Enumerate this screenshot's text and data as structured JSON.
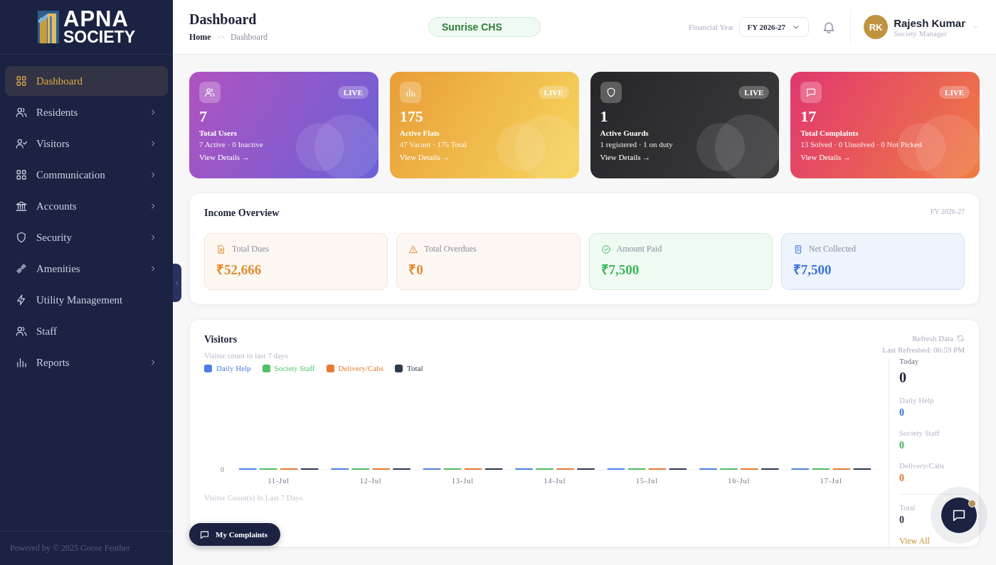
{
  "sidebar": {
    "logo": {
      "line_1": "APNA",
      "line_2": "SOCIETY"
    },
    "items": [
      {
        "label": "Dashboard",
        "kind": "grid",
        "selected": true,
        "has_submenu": false
      },
      {
        "label": "Residents",
        "kind": "users",
        "selected": false,
        "has_submenu": true
      },
      {
        "label": "Visitors",
        "kind": "user-check",
        "selected": false,
        "has_submenu": true
      },
      {
        "label": "Communication",
        "kind": "grid",
        "selected": false,
        "has_submenu": true
      },
      {
        "label": "Accounts",
        "kind": "bank",
        "selected": false,
        "has_submenu": true
      },
      {
        "label": "Security",
        "kind": "shield",
        "selected": false,
        "has_submenu": true
      },
      {
        "label": "Amenities",
        "kind": "dumbbell",
        "selected": false,
        "has_submenu": true
      },
      {
        "label": "Utility Management",
        "kind": "bolt",
        "selected": false,
        "has_submenu": false
      },
      {
        "label": "Staff",
        "kind": "users",
        "selected": false,
        "has_submenu": false
      },
      {
        "label": "Reports",
        "kind": "bars",
        "selected": false,
        "has_submenu": true
      }
    ],
    "footer": "Powered by © 2025 Goose Feather"
  },
  "header": {
    "title": "Dashboard",
    "breadcrumb": {
      "home": "Home",
      "separator": ">>",
      "current": "Dashboard"
    },
    "society": "Sunrise CHS",
    "financial_year": {
      "label": "Financial Year",
      "value": "FY 2026-27"
    },
    "user": {
      "initials": "RK",
      "name": "Rajesh Kumar",
      "role": "Society Manager"
    }
  },
  "stat_cards": [
    {
      "kind": "users",
      "badge": "LIVE",
      "value": "7",
      "title": "Total Users",
      "detail": "7 Active · 0 Inactive",
      "link": "View Details →"
    },
    {
      "kind": "flats",
      "badge": "LIVE",
      "value": "175",
      "title": "Active Flats",
      "detail": "47 Vacant · 175 Total",
      "link": "View Details →"
    },
    {
      "kind": "guards",
      "badge": "LIVE",
      "value": "1",
      "title": "Active Guards",
      "detail": "1 registered · 1 on duty",
      "link": "View Details →"
    },
    {
      "kind": "complaints",
      "badge": "LIVE",
      "value": "17",
      "title": "Total Complaints",
      "detail": "13 Solved · 0 Unsolved · 0 Not Picked",
      "link": "View Details →"
    }
  ],
  "income": {
    "title": "Income Overview",
    "period": "FY 2026-27",
    "tiles": [
      {
        "kind": "dues",
        "label": "Total Dues",
        "value": "₹52,666"
      },
      {
        "kind": "overdues",
        "label": "Total Overdues",
        "value": "₹0"
      },
      {
        "kind": "paid",
        "label": "Amount Paid",
        "value": "₹7,500"
      },
      {
        "kind": "net",
        "label": "Net Collected",
        "value": "₹7,500"
      }
    ]
  },
  "visitors": {
    "title": "Visitors",
    "subtitle": "Visitor count in last 7 days",
    "refresh": "Refresh Data",
    "last_refreshed": "Last Refreshed: 06:59 PM",
    "axis_zero_label": "0",
    "legend": [
      {
        "name": "Daily Help",
        "color": "#4a7ee6"
      },
      {
        "name": "Society Staff",
        "color": "#4fbf63"
      },
      {
        "name": "Delivery/Cabs",
        "color": "#e57b30"
      },
      {
        "name": "Total",
        "color": "#2f3a4f"
      }
    ],
    "x_labels": [
      "11-Jul",
      "12-Jul",
      "13-Jul",
      "14-Jul",
      "15-Jul",
      "16-Jul",
      "17-Jul"
    ],
    "caption": "Visitor Count(s) In Last 7 Days.",
    "today": {
      "label": "Today",
      "value": "0",
      "breakdown": [
        {
          "label": "Daily Help",
          "value": "0",
          "color": "#3b6fd9"
        },
        {
          "label": "Society Staff",
          "value": "0",
          "color": "#3fb556"
        },
        {
          "label": "Delivery/Cabs",
          "value": "0",
          "color": "#e0782c"
        }
      ],
      "total_label": "Total",
      "total_value": "0"
    },
    "view_all": "View All"
  },
  "my_complaints": "My Complaints"
}
